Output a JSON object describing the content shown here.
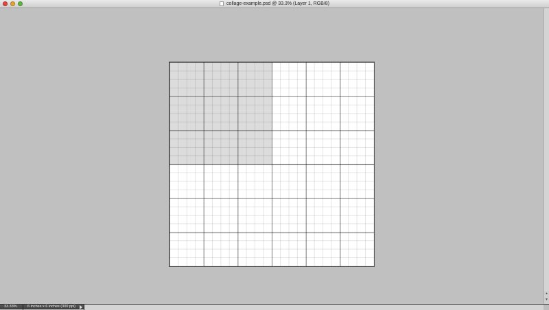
{
  "window": {
    "title": "collage-example.psd @ 33.3% (Layer 1, RGB/8)",
    "close_icon": "close-icon",
    "minimize_icon": "minimize-icon",
    "zoom_icon": "zoom-icon"
  },
  "status": {
    "zoom": "33.33%",
    "doc_info": "6 inches x 6 inches (300 ppi)"
  },
  "colors": {
    "workspace": "#c0c0c0",
    "selection": "#dcdcdc",
    "canvas": "#ffffff"
  }
}
